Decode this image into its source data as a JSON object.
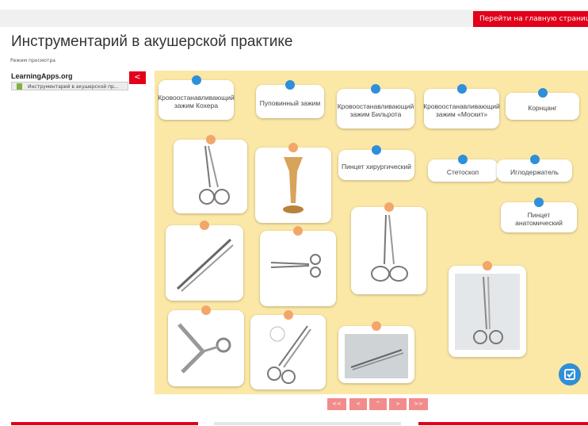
{
  "header": {
    "main_link": "Перейти на главную страницу курса",
    "title": "Инструментарий в акушерской практике",
    "mode": "Режим просмотра"
  },
  "sidebar": {
    "brand": "LearningApps.org",
    "item": "Инструментарий в акушерской пр...",
    "collapse": "<"
  },
  "cards": {
    "koher": "Кровоостанавливающий зажим Кохера",
    "pupovinny": "Пуповинный зажим",
    "bilrot": "Кровоостанавливающий зажим Бильрота",
    "moskit": "Кровоостанавливающий зажим «Москит»",
    "korntsang": "Корнцанг",
    "pintset_hir": "Пинцет хирургический",
    "stetoskop": "Стетоскоп",
    "iglo": "Иглодержатель",
    "pintset_anat": "Пинцет анатомический"
  },
  "pager": {
    "first": "<<",
    "prev": "<",
    "up": "^",
    "next": ">",
    "last": ">>"
  },
  "icons": {
    "check": "check-icon",
    "edit": "edit-icon"
  },
  "colors": {
    "accent_red": "#e2001a",
    "board": "#fbe8a6",
    "pin_blue": "#2f8fd8",
    "pin_orange": "#f2a66b"
  }
}
